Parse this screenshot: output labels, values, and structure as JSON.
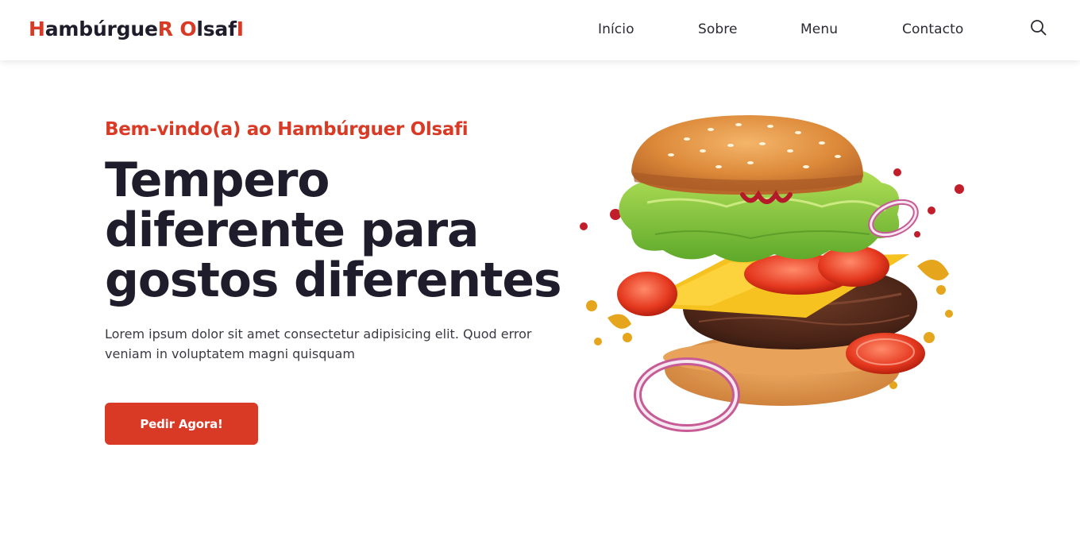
{
  "header": {
    "logo": {
      "p1": "H",
      "p2": "ambúrgue",
      "p3": "R",
      "p4": " ",
      "p5": "O",
      "p6": "lsaf",
      "p7": "I"
    },
    "nav": [
      "Início",
      "Sobre",
      "Menu",
      "Contacto"
    ],
    "search_icon": "search-icon"
  },
  "hero": {
    "subtitle": "Bem-vindo(a) ao Hambúrguer Olsafi",
    "headline": [
      "Tempero",
      "diferente para",
      "gostos diferentes"
    ],
    "description": "Lorem ipsum dolor sit amet consectetur adipisicing elit. Quod error veniam in voluptatem magni quisquam",
    "cta_label": "Pedir Agora!",
    "image": "burger-illustration"
  },
  "colors": {
    "accent": "#d93a26",
    "text": "#1f1d2b",
    "background": "#ffffff"
  }
}
